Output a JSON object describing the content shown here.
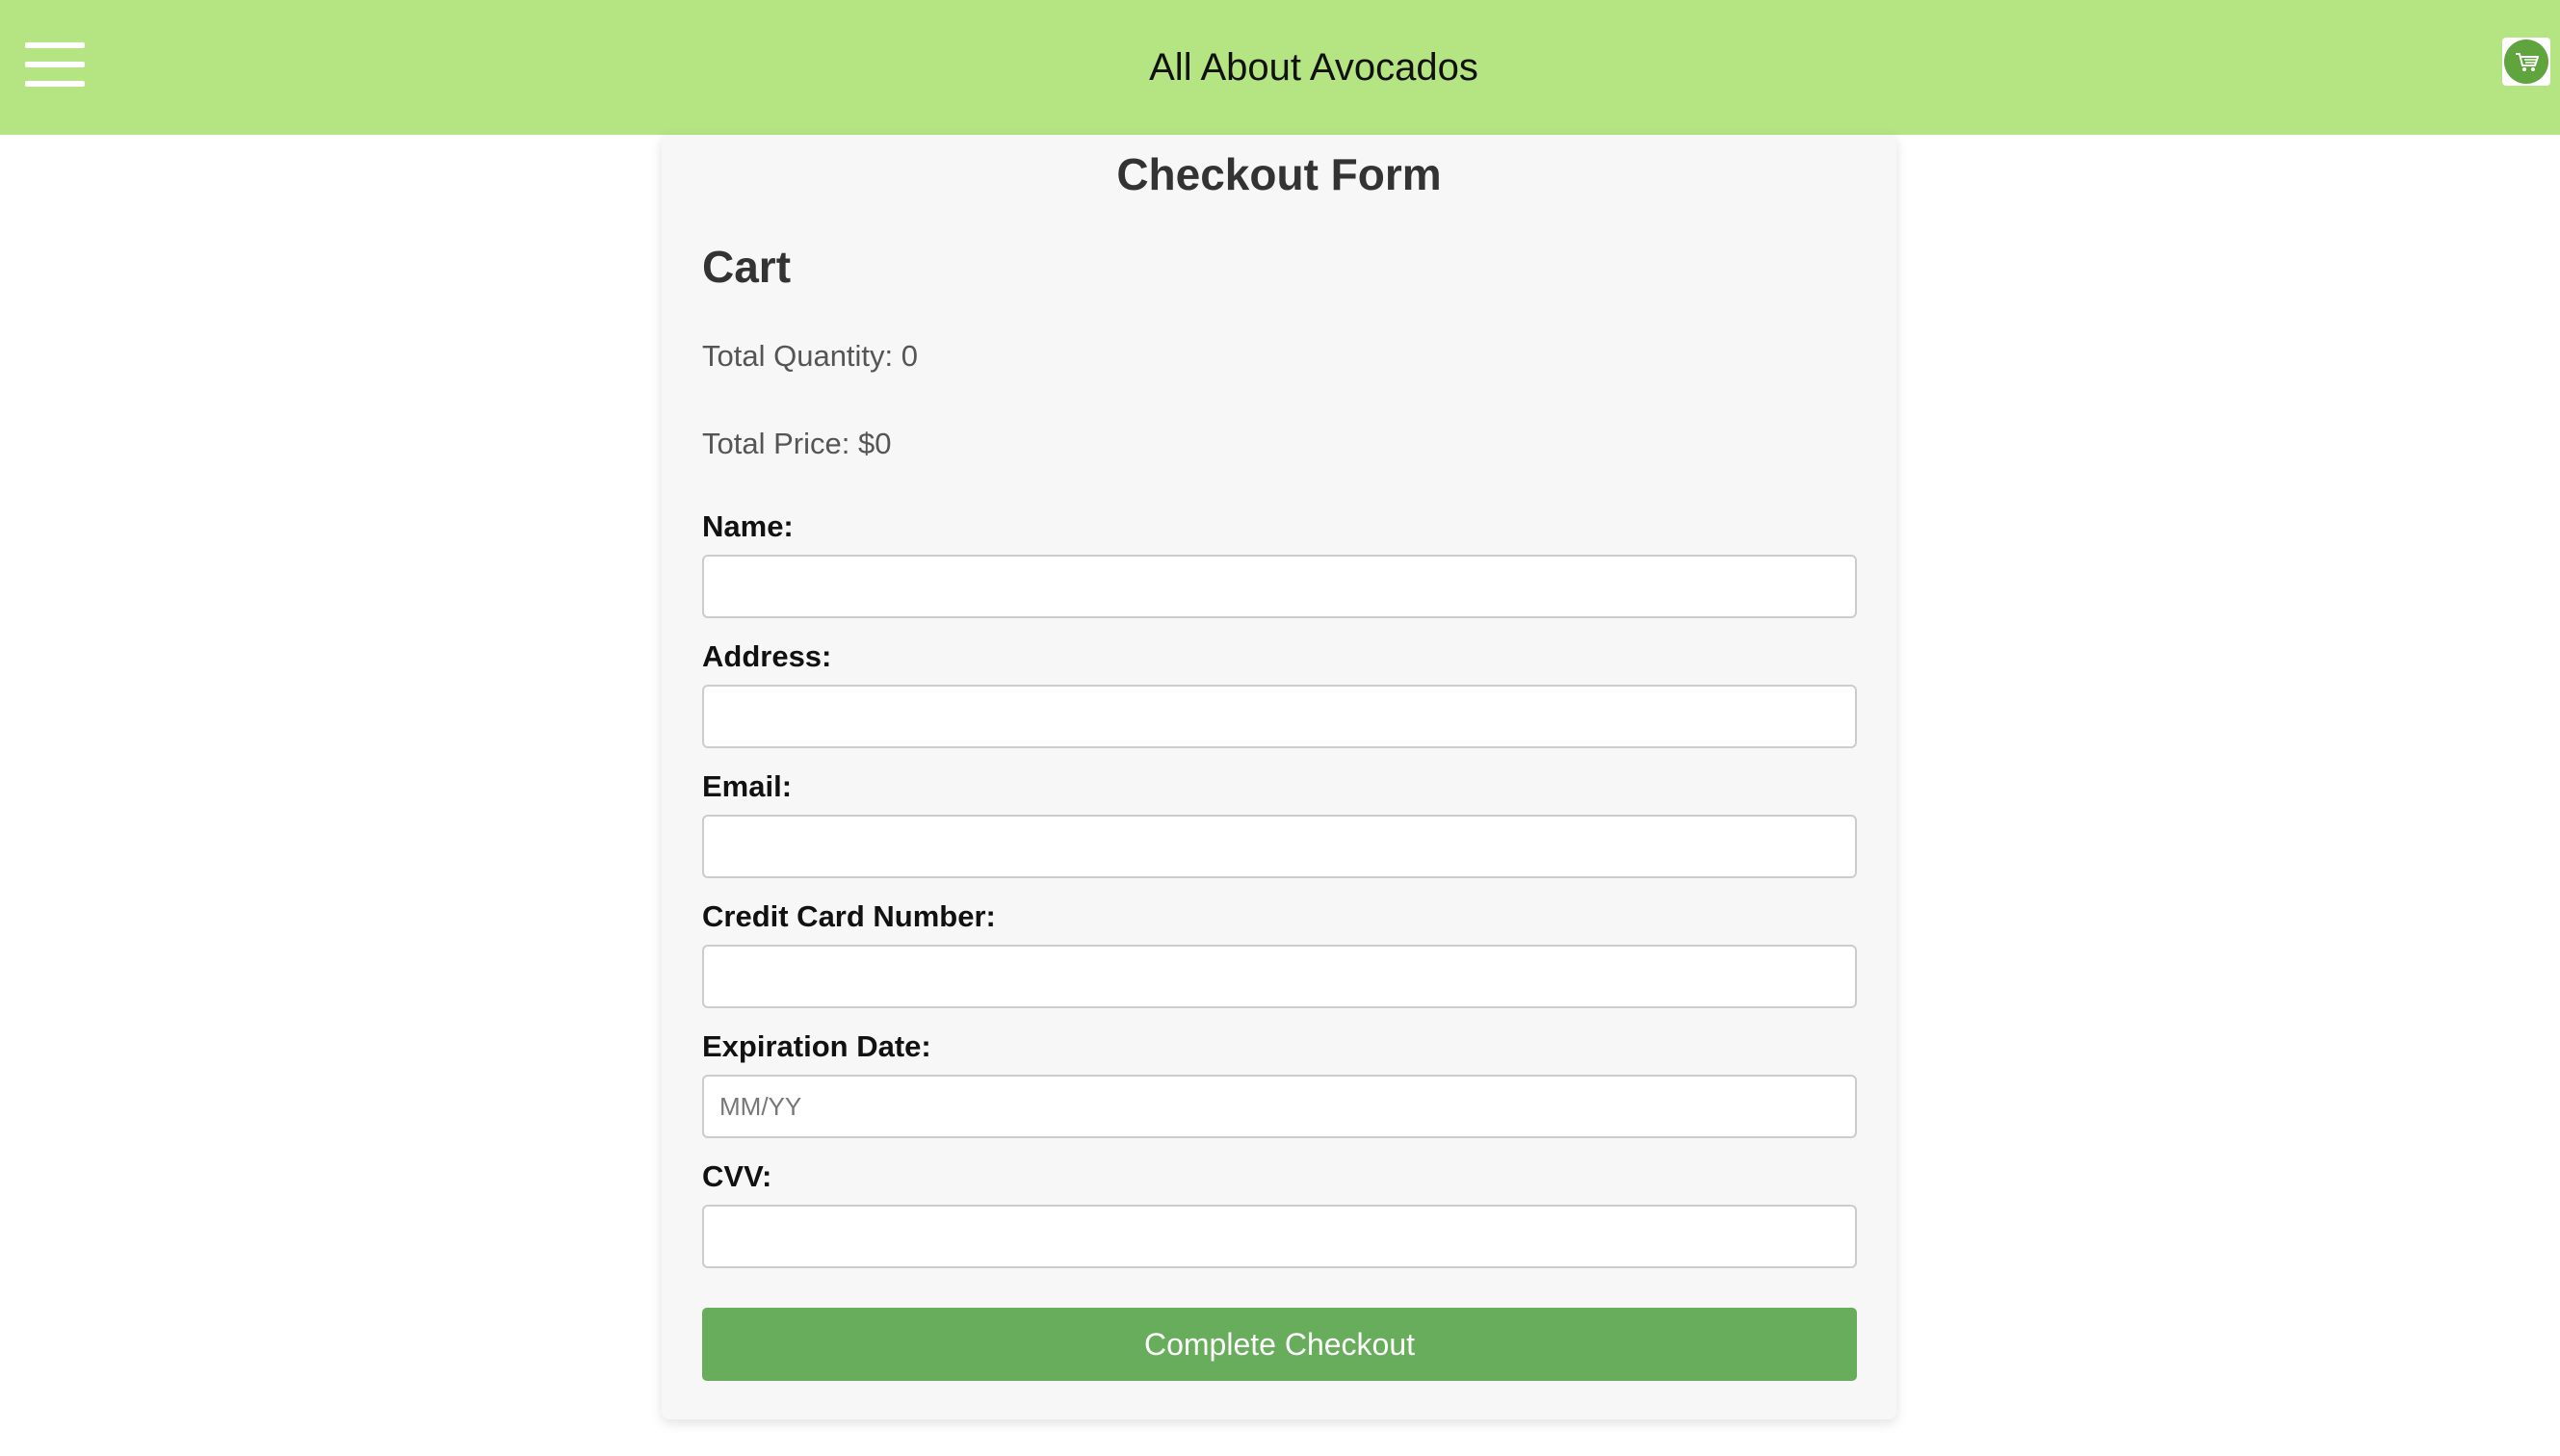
{
  "header": {
    "title": "All About Avocados",
    "menu_icon": "hamburger-menu-icon",
    "cart_icon": "shopping-cart-icon",
    "background_color": "#b5e582"
  },
  "checkout": {
    "title": "Checkout Form",
    "cart": {
      "heading": "Cart",
      "total_quantity": "Total Quantity: 0",
      "total_price": "Total Price: $0"
    },
    "fields": {
      "name": {
        "label": "Name:",
        "value": "",
        "placeholder": ""
      },
      "address": {
        "label": "Address:",
        "value": "",
        "placeholder": ""
      },
      "email": {
        "label": "Email:",
        "value": "",
        "placeholder": ""
      },
      "card_number": {
        "label": "Credit Card Number:",
        "value": "",
        "placeholder": ""
      },
      "expiration": {
        "label": "Expiration Date:",
        "value": "",
        "placeholder": "MM/YY"
      },
      "cvv": {
        "label": "CVV:",
        "value": "",
        "placeholder": ""
      }
    },
    "submit_label": "Complete Checkout",
    "accent_color": "#68ad5b"
  }
}
